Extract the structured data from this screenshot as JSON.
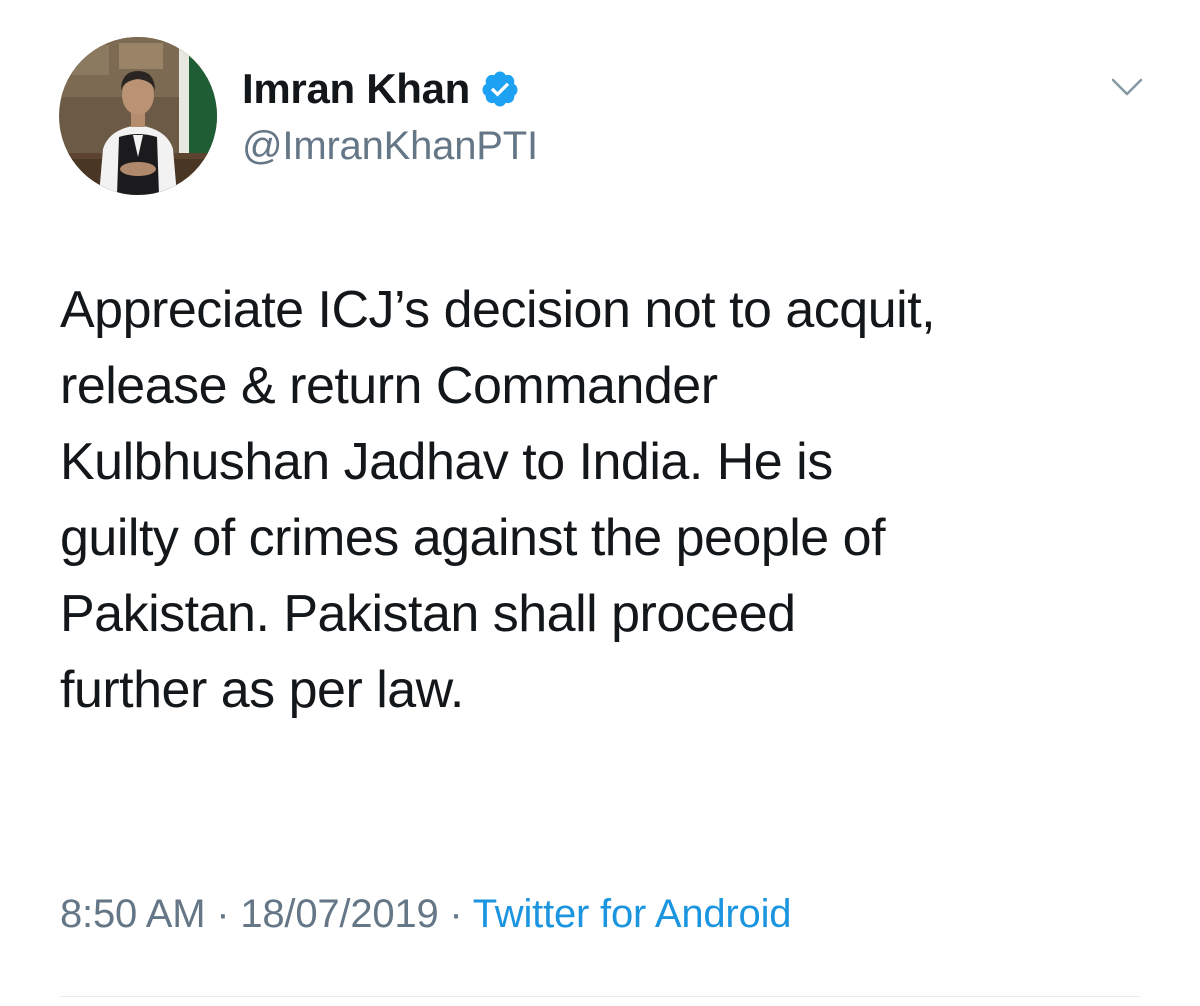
{
  "tweet": {
    "author": {
      "display_name": "Imran Khan",
      "handle": "@ImranKhanPTI",
      "verified": true,
      "avatar_icon": "profile-photo"
    },
    "menu_icon": "chevron-down-icon",
    "text_lines": [
      "Appreciate ICJ’s decision not to acquit,",
      "release & return Commander",
      "Kulbhushan Jadhav to India. He is",
      "guilty of crimes against the people of",
      "Pakistan. Pakistan shall proceed",
      "further as per law."
    ],
    "time": "8:50 AM",
    "separator": " · ",
    "date": "18/07/2019",
    "source": "Twitter for Android"
  },
  "colors": {
    "text_primary": "#14171a",
    "text_secondary": "#657786",
    "link_blue": "#1b95e0",
    "verified_blue": "#1da1f2",
    "divider": "#e6ecf0"
  }
}
